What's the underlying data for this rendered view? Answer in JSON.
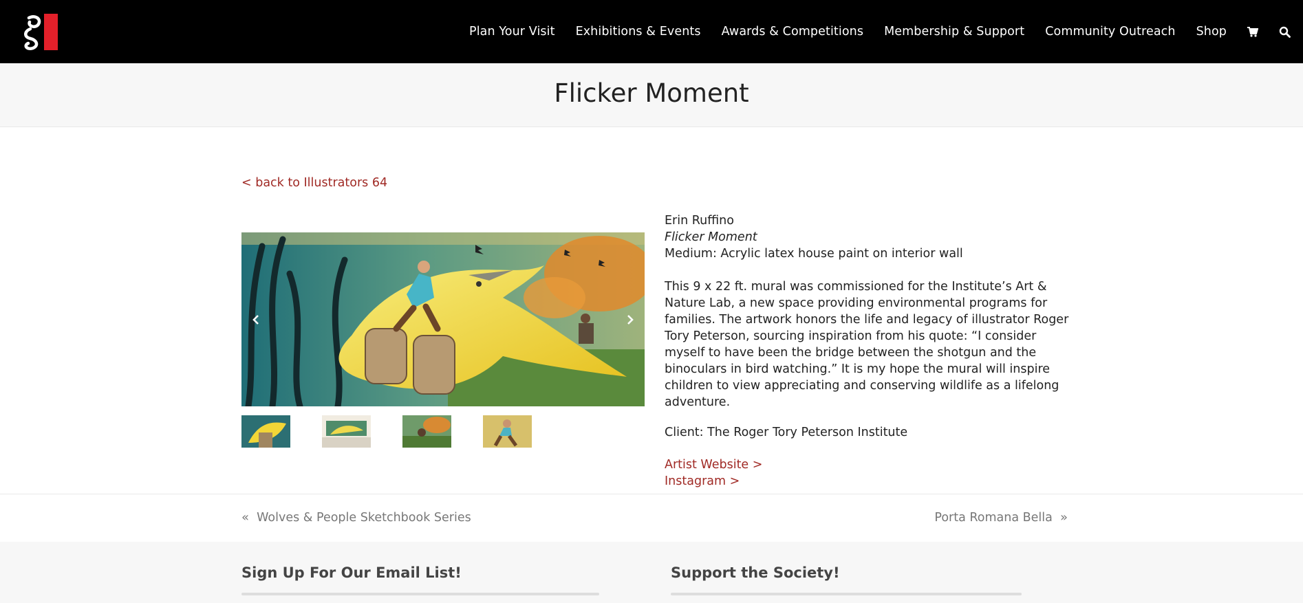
{
  "nav": {
    "items": [
      "Plan Your Visit",
      "Exhibitions & Events",
      "Awards & Competitions",
      "Membership & Support",
      "Community Outreach",
      "Shop"
    ],
    "cart_icon": "cart-icon",
    "search_icon": "search-icon"
  },
  "page": {
    "title": "Flicker Moment",
    "back_link": "< back to Illustrators 64"
  },
  "slider": {
    "prev_icon": "chevron-left-icon",
    "next_icon": "chevron-right-icon",
    "thumbnail_count": 4
  },
  "artwork": {
    "artist": "Erin Ruffino",
    "title": "Flicker Moment",
    "medium": "Medium: Acrylic latex house paint on interior wall",
    "description": "This 9 x 22 ft. mural was commissioned for the Institute’s Art & Nature Lab, a new space providing environmental programs for families. The artwork honors the life and legacy of illustrator Roger Tory Peterson, sourcing inspiration from his quote: “I consider myself to have been the bridge between the shotgun and the binoculars in bird watching.” It is my hope the mural will inspire children to view appreciating and conserving wildlife as a lifelong adventure.",
    "client": "Client: The Roger Tory Peterson Institute",
    "artist_website": "Artist Website >",
    "instagram": "Instagram >"
  },
  "post_nav": {
    "prev": "Wolves & People Sketchbook Series",
    "next": "Porta Romana Bella"
  },
  "footer": {
    "email_heading": "Sign Up For Our Email List!",
    "support_heading": "Support the Society!"
  },
  "colors": {
    "header_bg": "#000000",
    "accent_red": "#a02a25",
    "logo_red": "#e3202a"
  }
}
